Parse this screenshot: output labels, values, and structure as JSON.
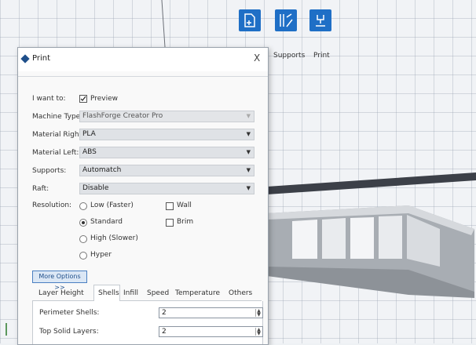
{
  "toolbar": {
    "buttons": [
      {
        "label": "",
        "icon": "add-file-icon"
      },
      {
        "label": "Supports",
        "icon": "supports-icon"
      },
      {
        "label": "Print",
        "icon": "print-icon"
      }
    ]
  },
  "dialog": {
    "title": "Print",
    "close_label": "X",
    "i_want_to": {
      "label": "I want to:",
      "preview_label": "Preview",
      "preview_checked": true
    },
    "machine_type": {
      "label": "Machine Type:",
      "value": "FlashForge Creator Pro"
    },
    "material_right": {
      "label": "Material Right:",
      "value": "PLA"
    },
    "material_left": {
      "label": "Material Left:",
      "value": "ABS"
    },
    "supports": {
      "label": "Supports:",
      "value": "Automatch"
    },
    "raft": {
      "label": "Raft:",
      "value": "Disable"
    },
    "resolution": {
      "label": "Resolution:",
      "options": [
        "Low (Faster)",
        "Standard",
        "High (Slower)",
        "Hyper"
      ],
      "selected": "Standard"
    },
    "extras": {
      "wall_label": "Wall",
      "brim_label": "Brim"
    },
    "more_options_label": "More Options >>",
    "tabs": [
      "Layer Height",
      "Shells",
      "Infill",
      "Speed",
      "Temperature",
      "Others"
    ],
    "active_tab": "Shells",
    "shells": {
      "perimeter_label": "Perimeter Shells:",
      "perimeter_value": "2",
      "top_solid_label": "Top Solid Layers:",
      "top_solid_value": "2"
    }
  },
  "colors": {
    "accent": "#1f6fc6",
    "model": "#bfc3c8"
  }
}
